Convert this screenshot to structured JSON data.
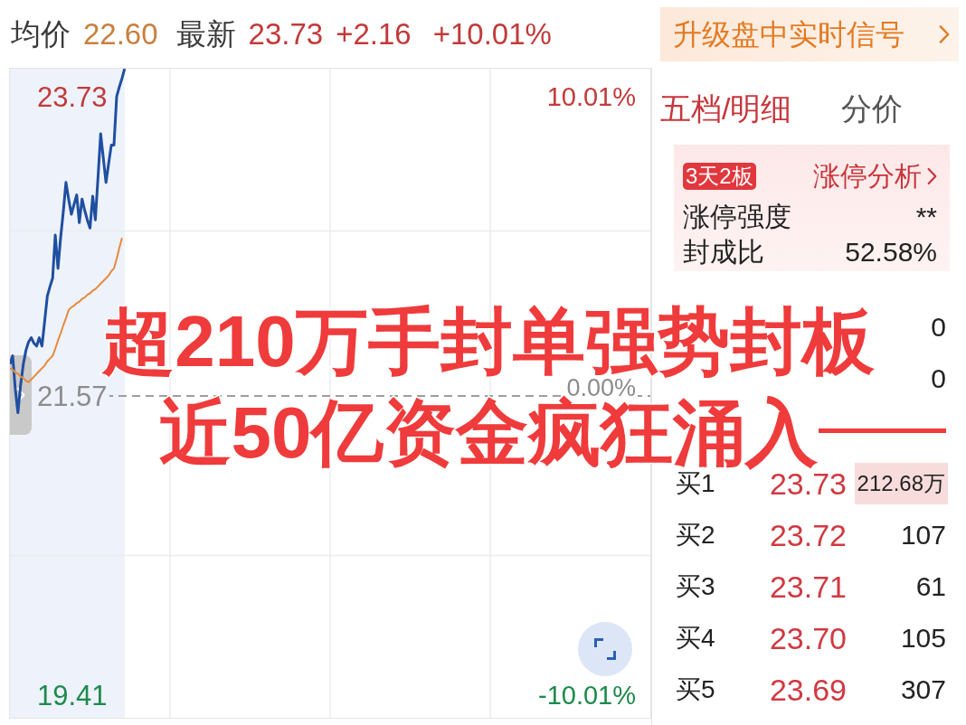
{
  "quote_bar": {
    "avg_label": "均价",
    "avg_value": "22.60",
    "last_label": "最新",
    "last_value": "23.73",
    "change": "+2.16",
    "change_pct": "+10.01%"
  },
  "upgrade_banner": {
    "label": "升级盘中实时信号"
  },
  "intraday_chart": {
    "percent_labels": [
      "10.01%",
      "0.00%",
      "-10.01%"
    ],
    "chart_data": {
      "type": "line",
      "ylim": [
        19.25,
        23.93
      ],
      "yticks": [
        {
          "value": 23.73,
          "label": "23.73"
        },
        {
          "value": 21.57,
          "label": "21.57"
        },
        {
          "value": 19.41,
          "label": "19.41"
        }
      ],
      "grid": true,
      "ref_lines": [
        {
          "axis": "y",
          "value": 21.57,
          "color": "#9e9e9e",
          "line_style": "dashed"
        }
      ],
      "categories": [
        null,
        null,
        null,
        null,
        null,
        null,
        null,
        null,
        null,
        null,
        null,
        null,
        null,
        null,
        null,
        null,
        null,
        null,
        null,
        null,
        null,
        null,
        null,
        null,
        null,
        null,
        null,
        null,
        null,
        null,
        null,
        null,
        null,
        null,
        null,
        null,
        null,
        null,
        null,
        null,
        null,
        null,
        null,
        null,
        null,
        null,
        null,
        null,
        null,
        null,
        null,
        null,
        null,
        null,
        null,
        null,
        null,
        null,
        null,
        null,
        null,
        null,
        null,
        null,
        null,
        null,
        null,
        null,
        null,
        null,
        null,
        null,
        null,
        null,
        null,
        null,
        null,
        null,
        null,
        null,
        null,
        null,
        null,
        null,
        null,
        null,
        null,
        null,
        null,
        null,
        null,
        null,
        null,
        null,
        null,
        null,
        null,
        null,
        null,
        null,
        null,
        null,
        null,
        null,
        null,
        null,
        null,
        null,
        null,
        null,
        null,
        null,
        null,
        null,
        null,
        null,
        null,
        null,
        null,
        null,
        null,
        null,
        null,
        null,
        null,
        null,
        null,
        null,
        null,
        null,
        null,
        null,
        null,
        null,
        null,
        null,
        null,
        null,
        null,
        null,
        null,
        null,
        null,
        null,
        null,
        null,
        null,
        null,
        null,
        null,
        null,
        null,
        null,
        null,
        null,
        null,
        null,
        null,
        null,
        null,
        null,
        null,
        null,
        null,
        null,
        null,
        null,
        null,
        null,
        null,
        null,
        null,
        null,
        null,
        null,
        null,
        null,
        null,
        null,
        null,
        null,
        null,
        null,
        null,
        null,
        null,
        null,
        null,
        null,
        null,
        null,
        null,
        null,
        null,
        null,
        null,
        null,
        null,
        null,
        null,
        null,
        null,
        null,
        null,
        null,
        null,
        null,
        null,
        null,
        null,
        null,
        null,
        null,
        null,
        null,
        null,
        null,
        null,
        null,
        null,
        null,
        null,
        null,
        null,
        null,
        null,
        null,
        null,
        null,
        null,
        null,
        null,
        null,
        null,
        null,
        null,
        null,
        null,
        null,
        null,
        null
      ],
      "series": [
        {
          "color": "#1f4fa0",
          "values": [
            21.8,
            21.86,
            21.62,
            21.45,
            21.65,
            21.8,
            21.9,
            21.96,
            21.99,
            21.95,
            21.93,
            21.99,
            21.93,
            22.11,
            22.29,
            22.36,
            22.42,
            22.73,
            22.49,
            22.71,
            22.9,
            23.11,
            22.99,
            22.88,
            22.95,
            23.02,
            22.82,
            22.99,
            22.91,
            22.84,
            22.78,
            23.01,
            22.84,
            23.15,
            23.46,
            23.28,
            23.11,
            23.25,
            23.38,
            23.38,
            23.73,
            23.8,
            23.86,
            23.93,
            null,
            null,
            null,
            null,
            null,
            null,
            null,
            null,
            null,
            null,
            null,
            null,
            null,
            null,
            null,
            null,
            null,
            null,
            null,
            null,
            null,
            null,
            null,
            null,
            null,
            null,
            null,
            null,
            null,
            null,
            null,
            null,
            null,
            null,
            null,
            null,
            null,
            null,
            null,
            null,
            null,
            null,
            null,
            null,
            null,
            null,
            null,
            null,
            null,
            null,
            null,
            null,
            null,
            null,
            null,
            null,
            null,
            null,
            null,
            null,
            null,
            null,
            null,
            null,
            null,
            null,
            null,
            null,
            null,
            null,
            null,
            null,
            null,
            null,
            null,
            null,
            null,
            null,
            null,
            null,
            null,
            null,
            null,
            null,
            null,
            null,
            null,
            null,
            null,
            null,
            null,
            null,
            null,
            null,
            null,
            null,
            null,
            null,
            null,
            null,
            null,
            null,
            null,
            null,
            null,
            null,
            null,
            null,
            null,
            null,
            null,
            null,
            null,
            null,
            null,
            null,
            null,
            null,
            null,
            null,
            null,
            null,
            null,
            null,
            null,
            null,
            null,
            null,
            null,
            null,
            null,
            null,
            null,
            null,
            null,
            null,
            null,
            null,
            null,
            null,
            null,
            null,
            null,
            null,
            null,
            null,
            null,
            null,
            null,
            null,
            null,
            null,
            null,
            null,
            null,
            null,
            null,
            null,
            null,
            null,
            null,
            null,
            null,
            null,
            null,
            null,
            null,
            null,
            null,
            null,
            null,
            null,
            null,
            null,
            null,
            null,
            null,
            null,
            null,
            null,
            null,
            null,
            null,
            null,
            null,
            null,
            null,
            null,
            null,
            null,
            null,
            null,
            null,
            null,
            null,
            null,
            null
          ]
        },
        {
          "color": "#e58a3e",
          "values": [
            21.77,
            21.76,
            21.74,
            21.73,
            21.71,
            21.7,
            21.68,
            21.67,
            21.69,
            21.71,
            21.73,
            21.75,
            21.77,
            21.79,
            21.82,
            21.84,
            21.86,
            21.91,
            21.97,
            22.02,
            22.08,
            22.13,
            22.19,
            22.21,
            22.22,
            22.24,
            22.25,
            22.27,
            22.28,
            22.3,
            22.31,
            22.33,
            22.34,
            22.36,
            22.38,
            22.4,
            22.42,
            22.44,
            22.47,
            22.49,
            22.56,
            22.64,
            22.71,
            null,
            null,
            null,
            null,
            null,
            null,
            null,
            null,
            null,
            null,
            null,
            null,
            null,
            null,
            null,
            null,
            null,
            null,
            null,
            null,
            null,
            null,
            null,
            null,
            null,
            null,
            null,
            null,
            null,
            null,
            null,
            null,
            null,
            null,
            null,
            null,
            null,
            null,
            null,
            null,
            null,
            null,
            null,
            null,
            null,
            null,
            null,
            null,
            null,
            null,
            null,
            null,
            null,
            null,
            null,
            null,
            null,
            null,
            null,
            null,
            null,
            null,
            null,
            null,
            null,
            null,
            null,
            null,
            null,
            null,
            null,
            null,
            null,
            null,
            null,
            null,
            null,
            null,
            null,
            null,
            null,
            null,
            null,
            null,
            null,
            null,
            null,
            null,
            null,
            null,
            null,
            null,
            null,
            null,
            null,
            null,
            null,
            null,
            null,
            null,
            null,
            null,
            null,
            null,
            null,
            null,
            null,
            null,
            null,
            null,
            null,
            null,
            null,
            null,
            null,
            null,
            null,
            null,
            null,
            null,
            null,
            null,
            null,
            null,
            null,
            null,
            null,
            null,
            null,
            null,
            null,
            null,
            null,
            null,
            null,
            null,
            null,
            null,
            null,
            null,
            null,
            null,
            null,
            null,
            null,
            null,
            null,
            null,
            null,
            null,
            null,
            null,
            null,
            null,
            null,
            null,
            null,
            null,
            null,
            null,
            null,
            null,
            null,
            null,
            null,
            null,
            null,
            null,
            null,
            null,
            null,
            null,
            null,
            null,
            null,
            null,
            null,
            null,
            null,
            null,
            null,
            null,
            null,
            null,
            null,
            null,
            null,
            null,
            null,
            null,
            null,
            null,
            null,
            null,
            null,
            null,
            null,
            null
          ]
        }
      ]
    }
  },
  "tabs": [
    {
      "label": "五档/明细",
      "selected": true
    },
    {
      "label": "分价",
      "selected": false
    }
  ],
  "limit_up_card": {
    "badge": "3天2板",
    "link": "涨停分析",
    "rows": [
      {
        "label": "涨停强度",
        "value": "**"
      },
      {
        "label": "封成比",
        "value": "52.58%"
      }
    ]
  },
  "sell_levels": [
    {
      "volume": "0"
    },
    {
      "volume": "0"
    }
  ],
  "buy_levels": [
    {
      "label": "买1",
      "price": "23.73",
      "volume": "212.68万",
      "highlighted": true
    },
    {
      "label": "买2",
      "price": "23.72",
      "volume": "107",
      "highlighted": false
    },
    {
      "label": "买3",
      "price": "23.71",
      "volume": "61",
      "highlighted": false
    },
    {
      "label": "买4",
      "price": "23.70",
      "volume": "105",
      "highlighted": false
    },
    {
      "label": "买5",
      "price": "23.69",
      "volume": "307",
      "highlighted": false
    }
  ],
  "headline": [
    "超210万手封单强势封板",
    "近50亿资金疯狂涌入"
  ]
}
